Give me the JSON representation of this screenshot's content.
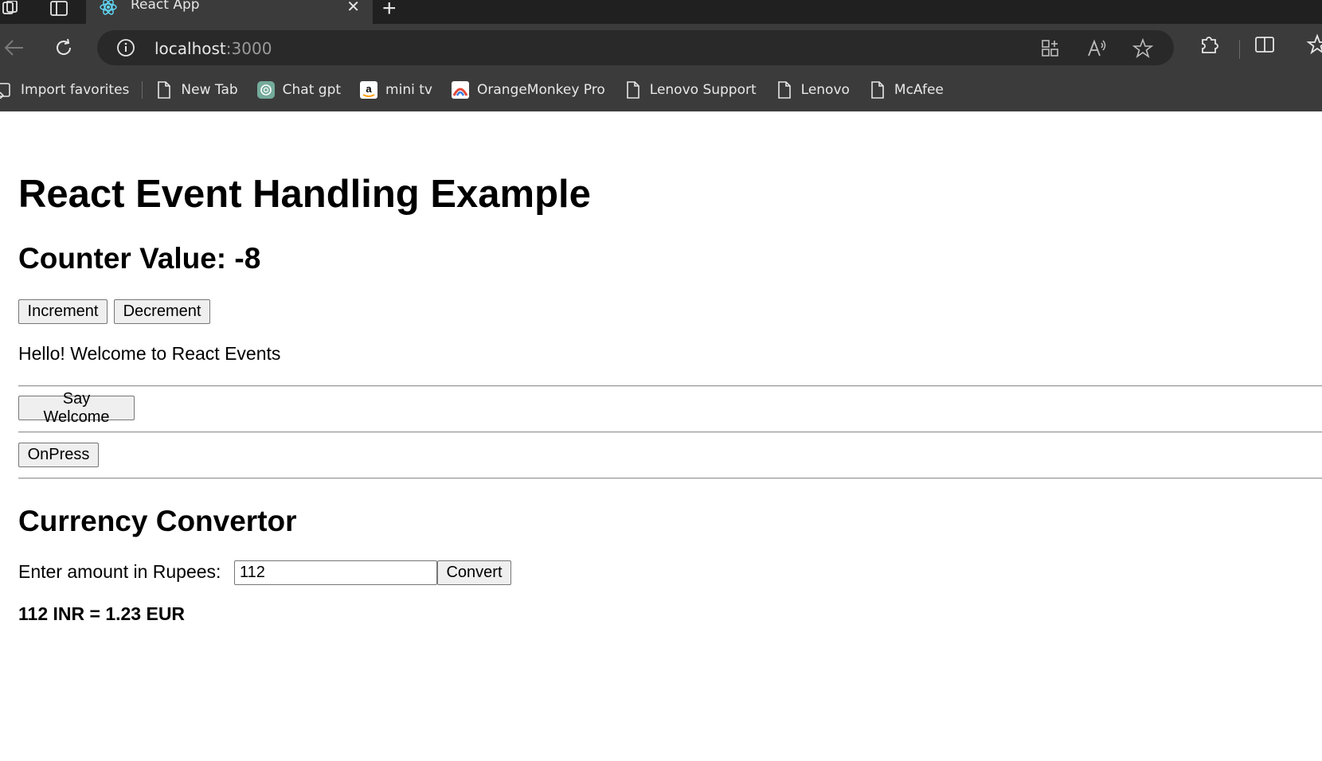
{
  "browser": {
    "tab_title": "React App",
    "url_host": "localhost",
    "url_port": ":3000",
    "bookmarks": [
      {
        "label": "Import favorites",
        "icon": "import-favorites-icon"
      },
      {
        "label": "New Tab",
        "icon": "page-icon"
      },
      {
        "label": "Chat gpt",
        "icon": "chatgpt-icon"
      },
      {
        "label": "mini tv",
        "icon": "amazon-icon"
      },
      {
        "label": "OrangeMonkey Pro",
        "icon": "orangemonkey-icon"
      },
      {
        "label": "Lenovo Support",
        "icon": "page-icon"
      },
      {
        "label": "Lenovo",
        "icon": "page-icon"
      },
      {
        "label": "McAfee",
        "icon": "page-icon"
      }
    ]
  },
  "app": {
    "title": "React Event Handling Example",
    "counter_label": "Counter Value: -8",
    "increment_label": "Increment",
    "decrement_label": "Decrement",
    "welcome_text": "Hello! Welcome to React Events",
    "say_welcome_label": "Say Welcome",
    "onpress_label": "OnPress",
    "currency_heading": "Currency Convertor",
    "amount_label": "Enter amount in Rupees:",
    "amount_value": "112",
    "convert_label": "Convert",
    "result_text": "112 INR = 1.23 EUR"
  },
  "colors": {
    "chrome_bg": "#3b3b3b",
    "tabstrip_bg": "#202020",
    "omnibox_bg": "#292929"
  }
}
